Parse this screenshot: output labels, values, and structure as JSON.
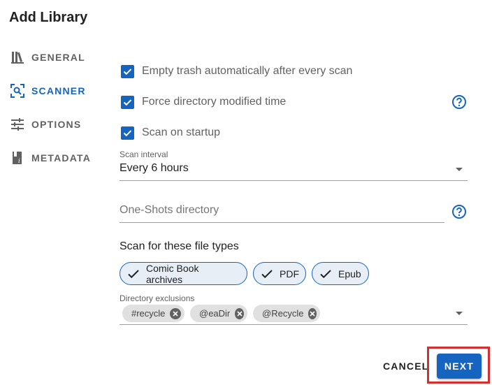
{
  "dialog": {
    "title": "Add Library"
  },
  "nav": {
    "items": [
      {
        "label": "GENERAL",
        "icon": "library-books-icon"
      },
      {
        "label": "SCANNER",
        "icon": "scanner-search-icon",
        "active": true
      },
      {
        "label": "OPTIONS",
        "icon": "tune-sliders-icon"
      },
      {
        "label": "METADATA",
        "icon": "book-info-icon"
      }
    ]
  },
  "scanner": {
    "checkboxes": [
      {
        "label": "Empty trash automatically after every scan",
        "checked": true
      },
      {
        "label": "Force directory modified time",
        "checked": true,
        "help": true
      },
      {
        "label": "Scan on startup",
        "checked": true
      }
    ],
    "scan_interval": {
      "label": "Scan interval",
      "value": "Every 6 hours"
    },
    "oneshots": {
      "placeholder": "One-Shots directory"
    },
    "file_types": {
      "label": "Scan for these file types",
      "chips": [
        {
          "label": "Comic Book archives",
          "selected": true
        },
        {
          "label": "PDF",
          "selected": true
        },
        {
          "label": "Epub",
          "selected": true
        }
      ]
    },
    "exclusions": {
      "label": "Directory exclusions",
      "tags": [
        "#recycle",
        "@eaDir",
        "@Recycle"
      ]
    }
  },
  "actions": {
    "cancel": "CANCEL",
    "next": "NEXT"
  },
  "colors": {
    "primary": "#1565c0",
    "highlight": "#d32f2f"
  }
}
